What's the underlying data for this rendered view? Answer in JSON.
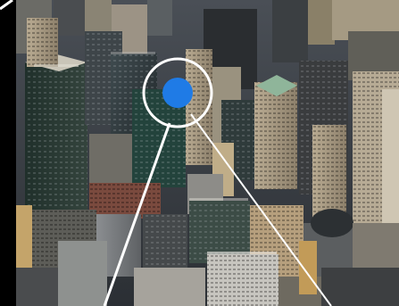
{
  "colors": {
    "frame_black": "#000000",
    "marker_blue": "#1f7be6",
    "ring_white": "#ffffff",
    "ray_white": "#ffffff"
  },
  "icons": {
    "location_marker": "location-dot-icon",
    "focus_ring": "focus-ring-icon"
  }
}
